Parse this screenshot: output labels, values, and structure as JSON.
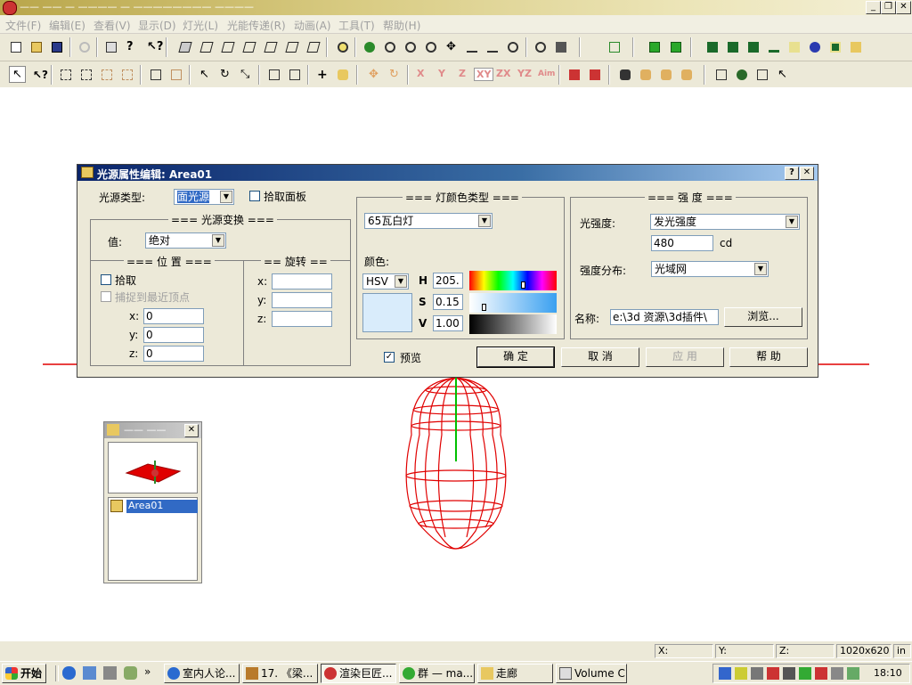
{
  "window": {
    "title": "—— —— — ———— —  ———————— ————"
  },
  "menu": [
    "文件(F)",
    "编辑(E)",
    "查看(V)",
    "显示(D)",
    "灯光(L)",
    "光能传递(R)",
    "动画(A)",
    "工具(T)",
    "帮助(H)"
  ],
  "toolbar2_axis": [
    "X",
    "Y",
    "Z",
    "XY",
    "ZX",
    "YZ",
    "Aim"
  ],
  "dialog": {
    "title": "光源属性编辑: Area01",
    "help_button": "?",
    "close_button": "✕",
    "light_type_label": "光源类型:",
    "light_type_value": "面光源",
    "pick_panel_label": "拾取面板",
    "transform_group": "=== 光源变换 ===",
    "value_label": "值:",
    "value_value": "绝对",
    "position_group": "=== 位 置 ===",
    "pick_label": "拾取",
    "snap_label": "捕捉到最近顶点",
    "pos": {
      "x_label": "x:",
      "x_value": "0",
      "y_label": "y:",
      "y_value": "0",
      "z_label": "z:",
      "z_value": "0"
    },
    "rotation_group": "== 旋转 ==",
    "rot": {
      "x_label": "x:",
      "x_value": "",
      "y_label": "y:",
      "y_value": "",
      "z_label": "z:",
      "z_value": ""
    },
    "light_color_group": "=== 灯颜色类型 ===",
    "lamp_type_value": "65瓦白灯",
    "color_label": "颜色:",
    "color_model": "HSV",
    "h_label": "H",
    "h_value": "205.",
    "s_label": "S",
    "s_value": "0.15",
    "v_label": "V",
    "v_value": "1.00",
    "swatch_color": "#d9ecfb",
    "intensity_group": "=== 强 度 ===",
    "intensity_label": "光强度:",
    "intensity_type": "发光强度",
    "intensity_value": "480",
    "intensity_unit": "cd",
    "distribution_label": "强度分布:",
    "distribution_value": "光域网",
    "name_label": "名称:",
    "name_value": "e:\\3d 资源\\3d插件\\",
    "browse_button": "浏览...",
    "preview_label": "预览",
    "ok_button": "确  定",
    "cancel_button": "取  消",
    "apply_button": "应  用",
    "help_text_button": "帮  助"
  },
  "panel": {
    "title": "——  ——",
    "item": "Area01"
  },
  "status": {
    "x": "X:",
    "y": "Y:",
    "z": "Z:",
    "resolution": "1020x620",
    "unit": "in"
  },
  "taskbar": {
    "start": "开始",
    "tasks": [
      "室内人论...",
      "17. 《梁...",
      "渲染巨匠...",
      "群 — ma...",
      "走廊",
      "Volume C..."
    ],
    "clock": "18:10"
  },
  "colors": {
    "accent": "#0a246a",
    "model_red": "#e00000"
  }
}
